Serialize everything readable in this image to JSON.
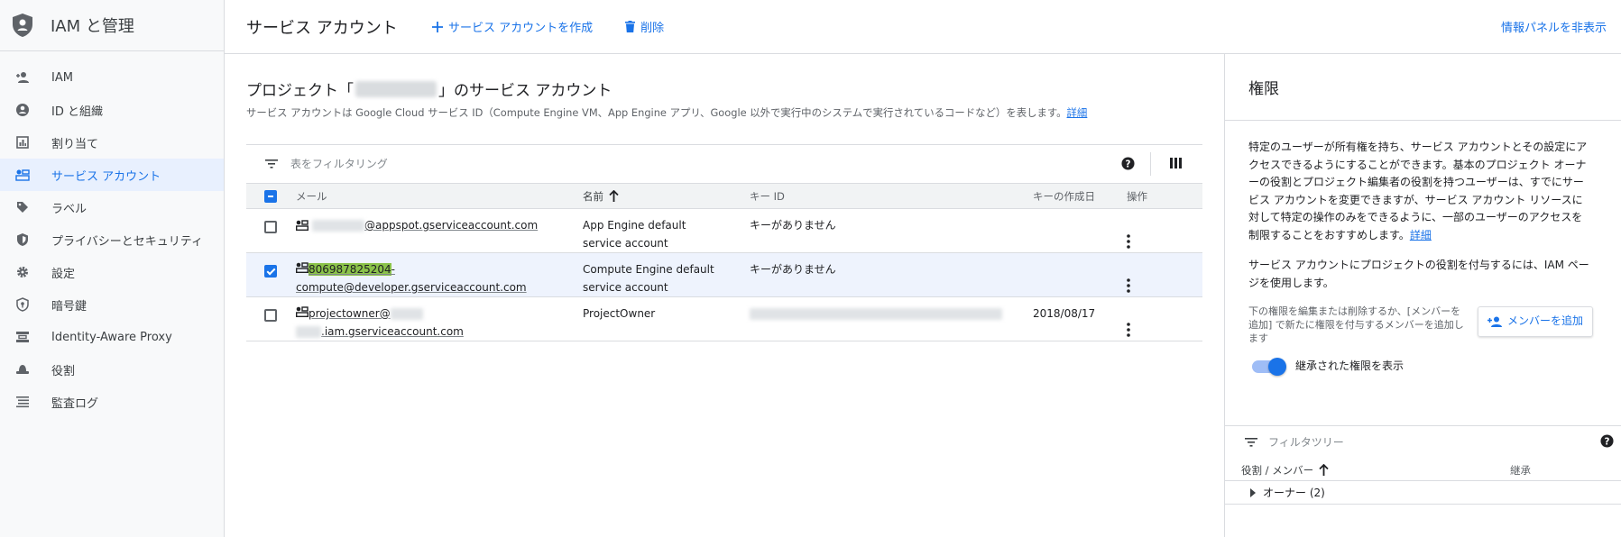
{
  "app": {
    "title": "IAM と管理"
  },
  "sidebar": {
    "items": [
      {
        "label": "IAM",
        "icon": "person-add-icon"
      },
      {
        "label": "ID と組織",
        "icon": "account-circle-icon"
      },
      {
        "label": "割り当て",
        "icon": "quota-icon"
      },
      {
        "label": "サービス アカウント",
        "icon": "service-account-icon",
        "active": true
      },
      {
        "label": "ラベル",
        "icon": "label-icon"
      },
      {
        "label": "プライバシーとセキュリティ",
        "icon": "shield-icon"
      },
      {
        "label": "設定",
        "icon": "gear-icon"
      },
      {
        "label": "暗号鍵",
        "icon": "key-shield-icon"
      },
      {
        "label": "Identity-Aware Proxy",
        "icon": "proxy-icon"
      },
      {
        "label": "役割",
        "icon": "hat-icon"
      },
      {
        "label": "監査ログ",
        "icon": "list-icon"
      }
    ]
  },
  "topbar": {
    "title": "サービス アカウント",
    "create_label": "サービス アカウントを作成",
    "delete_label": "削除",
    "hide_panel_label": "情報パネルを非表示"
  },
  "main": {
    "title_prefix": "プロジェクト「",
    "title_suffix": "」のサービス アカウント",
    "description": "サービス アカウントは Google Cloud サービス ID（Compute Engine VM、App Engine アプリ、Google 以外で実行中のシステムで実行されているコードなど）を表します。",
    "details_link": "詳細",
    "filter_placeholder": "表をフィルタリング",
    "columns": {
      "email": "メール",
      "name": "名前",
      "key_id": "キー ID",
      "key_created": "キーの作成日",
      "actions": "操作"
    },
    "rows": [
      {
        "email_line1_suffix": "@appspot.gserviceaccount.com",
        "name_line1": "App Engine default",
        "name_line2": "service account",
        "key_id": "キーがありません",
        "key_created": "",
        "checked": false
      },
      {
        "email_highlight": "806987825204",
        "email_line1_suffix": "-",
        "email_line2": "compute@developer.gserviceaccount.com",
        "name_line1": "Compute Engine default",
        "name_line2": "service account",
        "key_id": "キーがありません",
        "key_created": "",
        "checked": true
      },
      {
        "email_line1": "projectowner@",
        "email_line2_suffix": ".iam.gserviceaccount.com",
        "name_line1": "ProjectOwner",
        "name_line2": "",
        "key_id": "",
        "key_created": "2018/08/17",
        "checked": false
      }
    ]
  },
  "panel": {
    "title": "権限",
    "para1": "特定のユーザーが所有権を持ち、サービス アカウントとその設定にアクセスできるようにすることができます。基本のプロジェクト オーナーの役割とプロジェクト編集者の役割を持つユーザーは、すでにサービス アカウントを変更できますが、サービス アカウント リソースに対して特定の操作のみをできるように、一部のユーザーのアクセスを制限することをおすすめします。",
    "para1_link": "詳細",
    "para2": "サービス アカウントにプロジェクトの役割を付与するには、IAM ページを使用します。",
    "member_note": "下の権限を編集または削除するか、[メンバーを追加] で新たに権限を付与するメンバーを追加します",
    "add_member_label": "メンバーを追加",
    "toggle_label": "継承された権限を表示",
    "tree_filter_placeholder": "フィルタツリー",
    "tree_col1": "役割 / メンバー",
    "tree_col2": "継承",
    "tree_row": "オーナー (2)"
  },
  "colors": {
    "accent": "#1a73e8",
    "highlight": "#8bc34a"
  }
}
